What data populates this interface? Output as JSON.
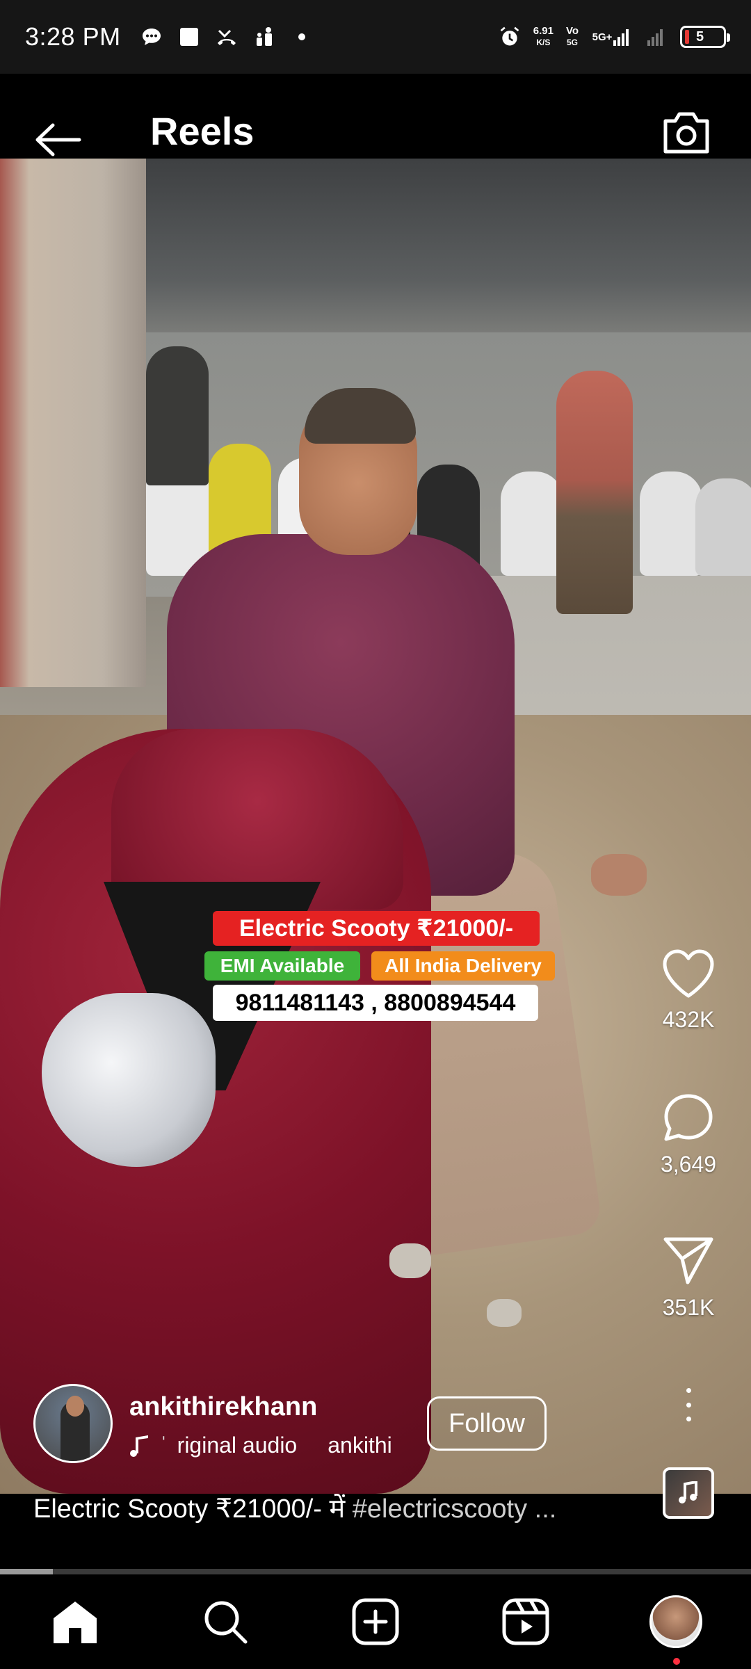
{
  "status_bar": {
    "time": "3:28 PM",
    "net_speed_value": "6.91",
    "net_speed_unit": "K/S",
    "sim1": "Vo",
    "sim1_line2": "5G",
    "sim2": "5G+",
    "battery_level": "5",
    "battery_color": "#e53935",
    "icons": [
      "chat-bubble-icon",
      "square-app-icon",
      "missed-call-icon",
      "people-icon",
      "dot-icon",
      "alarm-icon",
      "signal-icon",
      "signal-weak-icon",
      "battery-icon"
    ]
  },
  "header": {
    "title": "Reels",
    "back_icon": "arrow-left-icon",
    "camera_icon": "camera-icon"
  },
  "overlay": {
    "price_text": "Electric Scooty ₹21000/-",
    "emi_text": "EMI Available",
    "delivery_text": "All India Delivery",
    "phone_text": "9811481143 , 8800894544",
    "colors": {
      "price_bg": "#e52222",
      "emi_bg": "#3fb33a",
      "delivery_bg": "#f28c1b"
    }
  },
  "actions": {
    "likes": "432K",
    "comments": "3,649",
    "shares": "351K"
  },
  "author": {
    "username": "ankithirekhann",
    "follow_label": "Follow",
    "audio_label": "riginal audio",
    "audio_owner": "ankithi"
  },
  "caption": {
    "text": "Electric Scooty ₹21000/- में ",
    "hashtag": "#electricscooty ..."
  },
  "progress": {
    "value": 0.07
  },
  "bottom_nav": {
    "items": [
      "home-icon",
      "search-icon",
      "create-icon",
      "reels-icon",
      "profile-avatar"
    ]
  }
}
